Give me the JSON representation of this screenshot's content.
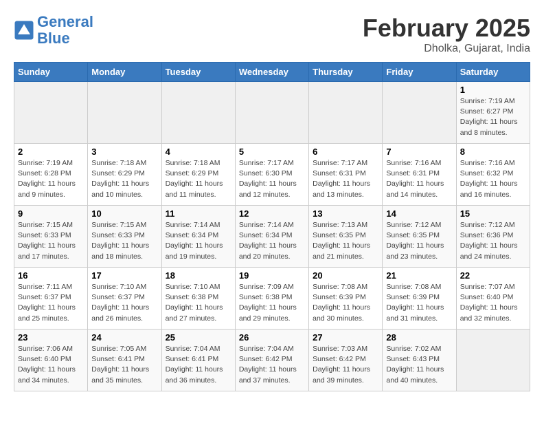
{
  "header": {
    "logo_line1": "General",
    "logo_line2": "Blue",
    "month_title": "February 2025",
    "subtitle": "Dholka, Gujarat, India"
  },
  "days_of_week": [
    "Sunday",
    "Monday",
    "Tuesday",
    "Wednesday",
    "Thursday",
    "Friday",
    "Saturday"
  ],
  "weeks": [
    [
      {
        "day": "",
        "info": ""
      },
      {
        "day": "",
        "info": ""
      },
      {
        "day": "",
        "info": ""
      },
      {
        "day": "",
        "info": ""
      },
      {
        "day": "",
        "info": ""
      },
      {
        "day": "",
        "info": ""
      },
      {
        "day": "1",
        "info": "Sunrise: 7:19 AM\nSunset: 6:27 PM\nDaylight: 11 hours and 8 minutes."
      }
    ],
    [
      {
        "day": "2",
        "info": "Sunrise: 7:19 AM\nSunset: 6:28 PM\nDaylight: 11 hours and 9 minutes."
      },
      {
        "day": "3",
        "info": "Sunrise: 7:18 AM\nSunset: 6:29 PM\nDaylight: 11 hours and 10 minutes."
      },
      {
        "day": "4",
        "info": "Sunrise: 7:18 AM\nSunset: 6:29 PM\nDaylight: 11 hours and 11 minutes."
      },
      {
        "day": "5",
        "info": "Sunrise: 7:17 AM\nSunset: 6:30 PM\nDaylight: 11 hours and 12 minutes."
      },
      {
        "day": "6",
        "info": "Sunrise: 7:17 AM\nSunset: 6:31 PM\nDaylight: 11 hours and 13 minutes."
      },
      {
        "day": "7",
        "info": "Sunrise: 7:16 AM\nSunset: 6:31 PM\nDaylight: 11 hours and 14 minutes."
      },
      {
        "day": "8",
        "info": "Sunrise: 7:16 AM\nSunset: 6:32 PM\nDaylight: 11 hours and 16 minutes."
      }
    ],
    [
      {
        "day": "9",
        "info": "Sunrise: 7:15 AM\nSunset: 6:33 PM\nDaylight: 11 hours and 17 minutes."
      },
      {
        "day": "10",
        "info": "Sunrise: 7:15 AM\nSunset: 6:33 PM\nDaylight: 11 hours and 18 minutes."
      },
      {
        "day": "11",
        "info": "Sunrise: 7:14 AM\nSunset: 6:34 PM\nDaylight: 11 hours and 19 minutes."
      },
      {
        "day": "12",
        "info": "Sunrise: 7:14 AM\nSunset: 6:34 PM\nDaylight: 11 hours and 20 minutes."
      },
      {
        "day": "13",
        "info": "Sunrise: 7:13 AM\nSunset: 6:35 PM\nDaylight: 11 hours and 21 minutes."
      },
      {
        "day": "14",
        "info": "Sunrise: 7:12 AM\nSunset: 6:35 PM\nDaylight: 11 hours and 23 minutes."
      },
      {
        "day": "15",
        "info": "Sunrise: 7:12 AM\nSunset: 6:36 PM\nDaylight: 11 hours and 24 minutes."
      }
    ],
    [
      {
        "day": "16",
        "info": "Sunrise: 7:11 AM\nSunset: 6:37 PM\nDaylight: 11 hours and 25 minutes."
      },
      {
        "day": "17",
        "info": "Sunrise: 7:10 AM\nSunset: 6:37 PM\nDaylight: 11 hours and 26 minutes."
      },
      {
        "day": "18",
        "info": "Sunrise: 7:10 AM\nSunset: 6:38 PM\nDaylight: 11 hours and 27 minutes."
      },
      {
        "day": "19",
        "info": "Sunrise: 7:09 AM\nSunset: 6:38 PM\nDaylight: 11 hours and 29 minutes."
      },
      {
        "day": "20",
        "info": "Sunrise: 7:08 AM\nSunset: 6:39 PM\nDaylight: 11 hours and 30 minutes."
      },
      {
        "day": "21",
        "info": "Sunrise: 7:08 AM\nSunset: 6:39 PM\nDaylight: 11 hours and 31 minutes."
      },
      {
        "day": "22",
        "info": "Sunrise: 7:07 AM\nSunset: 6:40 PM\nDaylight: 11 hours and 32 minutes."
      }
    ],
    [
      {
        "day": "23",
        "info": "Sunrise: 7:06 AM\nSunset: 6:40 PM\nDaylight: 11 hours and 34 minutes."
      },
      {
        "day": "24",
        "info": "Sunrise: 7:05 AM\nSunset: 6:41 PM\nDaylight: 11 hours and 35 minutes."
      },
      {
        "day": "25",
        "info": "Sunrise: 7:04 AM\nSunset: 6:41 PM\nDaylight: 11 hours and 36 minutes."
      },
      {
        "day": "26",
        "info": "Sunrise: 7:04 AM\nSunset: 6:42 PM\nDaylight: 11 hours and 37 minutes."
      },
      {
        "day": "27",
        "info": "Sunrise: 7:03 AM\nSunset: 6:42 PM\nDaylight: 11 hours and 39 minutes."
      },
      {
        "day": "28",
        "info": "Sunrise: 7:02 AM\nSunset: 6:43 PM\nDaylight: 11 hours and 40 minutes."
      },
      {
        "day": "",
        "info": ""
      }
    ]
  ]
}
